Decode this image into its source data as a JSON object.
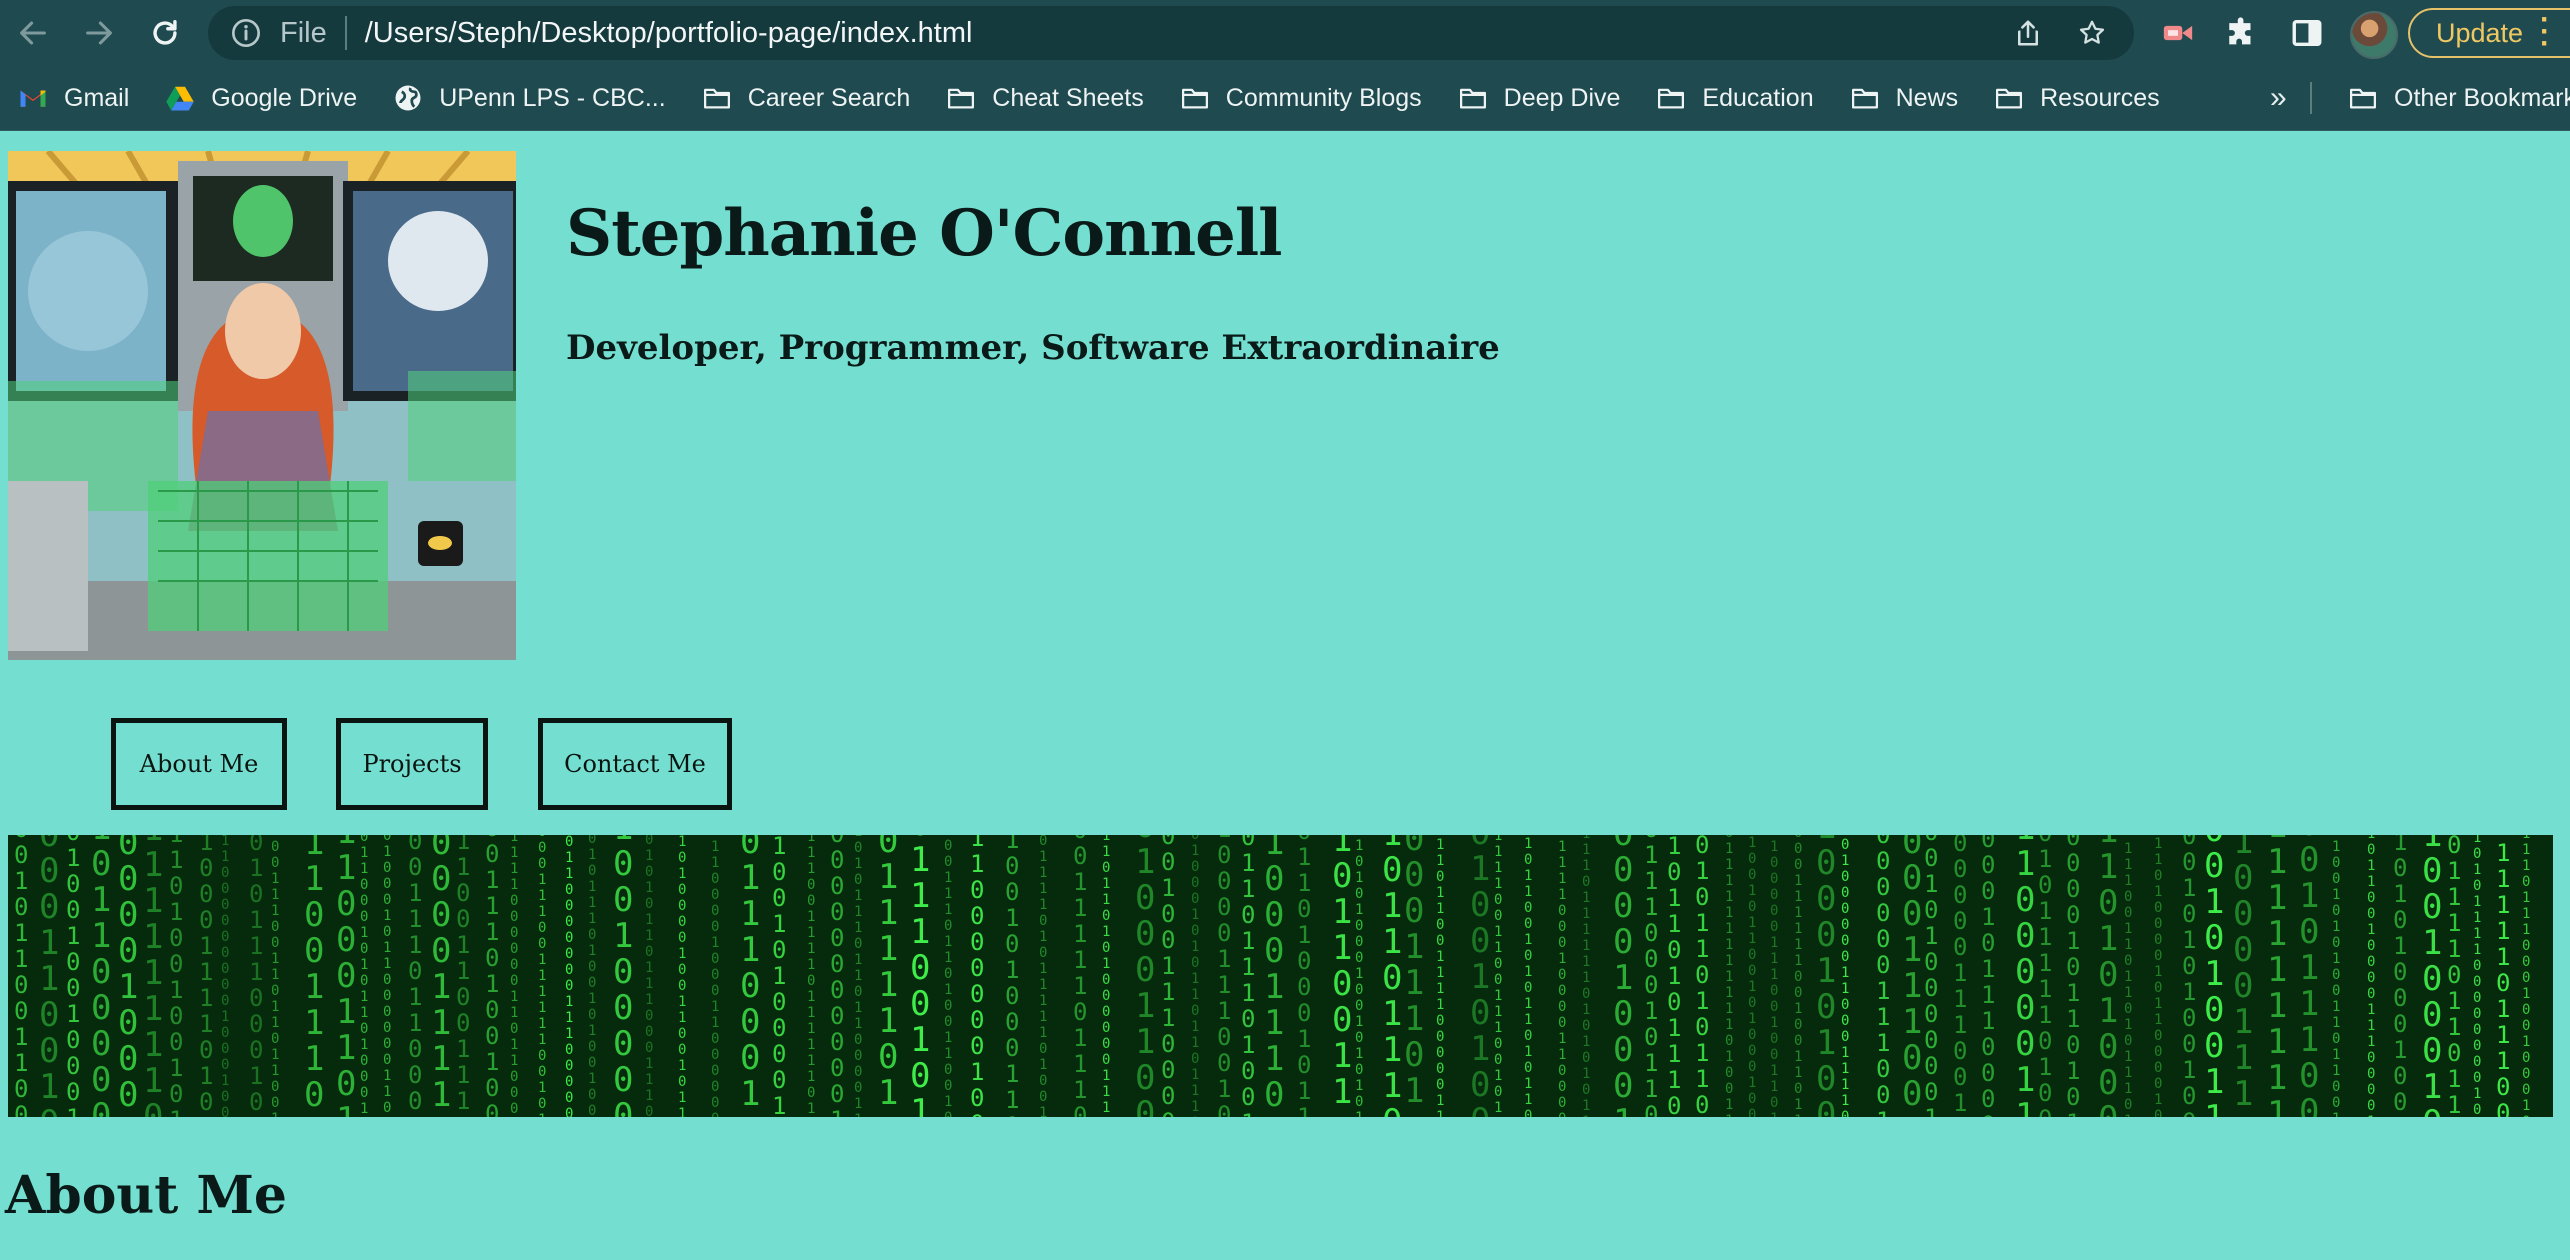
{
  "browser": {
    "url_scheme_label": "File",
    "url": "/Users/Steph/Desktop/portfolio-page/index.html",
    "update_label": "Update",
    "bookmarks": [
      {
        "label": "Gmail",
        "icon": "gmail-icon"
      },
      {
        "label": "Google Drive",
        "icon": "google-drive-icon"
      },
      {
        "label": "UPenn LPS - CBC...",
        "icon": "globe-icon"
      },
      {
        "label": "Career Search",
        "icon": "folder-icon"
      },
      {
        "label": "Cheat Sheets",
        "icon": "folder-icon"
      },
      {
        "label": "Community Blogs",
        "icon": "folder-icon"
      },
      {
        "label": "Deep Dive",
        "icon": "folder-icon"
      },
      {
        "label": "Education",
        "icon": "folder-icon"
      },
      {
        "label": "News",
        "icon": "folder-icon"
      },
      {
        "label": "Resources",
        "icon": "folder-icon"
      }
    ],
    "more_bookmarks_label": "»",
    "other_bookmarks_label": "Other Bookmarks"
  },
  "page": {
    "title": "Stephanie O'Connell",
    "subtitle": "Developer, Programmer, Software Extraordinaire",
    "nav": [
      "About Me",
      "Projects",
      "Contact Me"
    ],
    "section_heading": "About Me"
  },
  "colors": {
    "page_background": "#74dfd0",
    "chrome_background": "#1f4a4f",
    "matrix_green": "#3ff04a",
    "update_accent": "#f0c863"
  }
}
